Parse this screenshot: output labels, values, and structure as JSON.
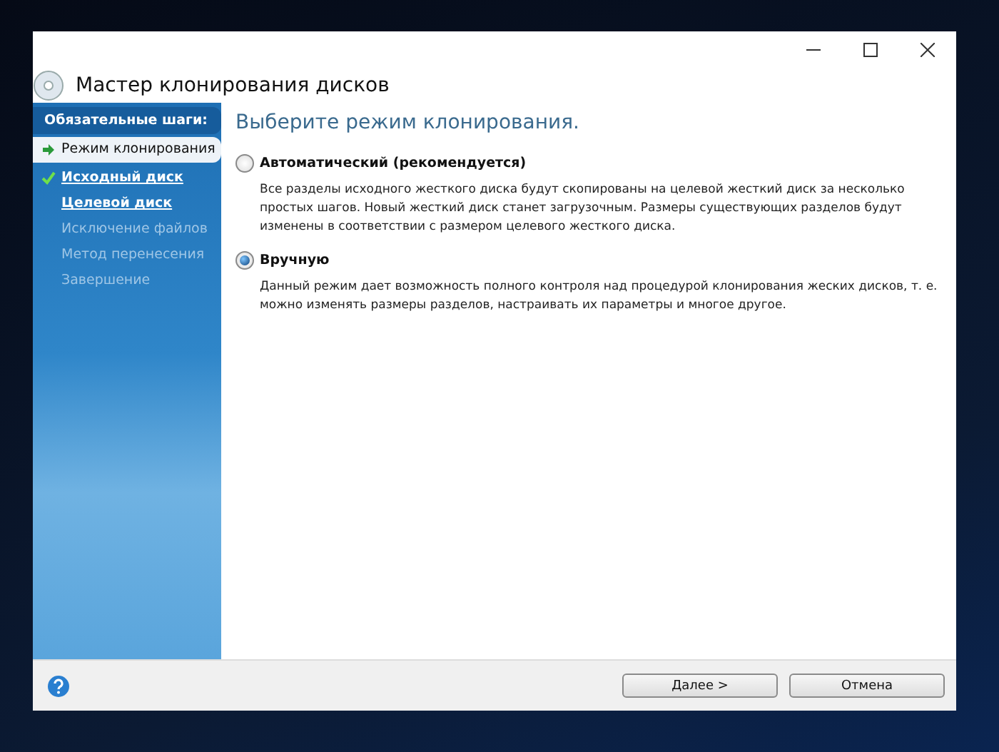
{
  "window": {
    "title": "Мастер клонирования дисков"
  },
  "sidebar": {
    "heading": "Обязательные шаги:",
    "items": [
      {
        "label": "Режим клонирования",
        "kind": "current"
      },
      {
        "label": "Исходный диск",
        "kind": "done"
      },
      {
        "label": "Целевой диск",
        "kind": "link"
      },
      {
        "label": "Исключение файлов",
        "kind": "disabled"
      },
      {
        "label": "Метод перенесения",
        "kind": "disabled"
      },
      {
        "label": "Завершение",
        "kind": "disabled"
      }
    ]
  },
  "content": {
    "heading": "Выберите режим клонирования.",
    "options": [
      {
        "label": "Автоматический (рекомендуется)",
        "selected": false,
        "description": "Все разделы исходного жесткого диска будут скопированы на целевой жесткий диск за несколько простых шагов. Новый жесткий диск станет загрузочным. Размеры существующих разделов будут изменены в соответствии с размером целевого жесткого диска."
      },
      {
        "label": "Вручную",
        "selected": true,
        "description": "Данный режим дает возможность полного контроля над процедурой клонирования жеских дисков, т. е. можно изменять размеры разделов, настраивать их параметры и многое другое."
      }
    ]
  },
  "buttons": [
    "Далее >",
    "Отмена"
  ]
}
